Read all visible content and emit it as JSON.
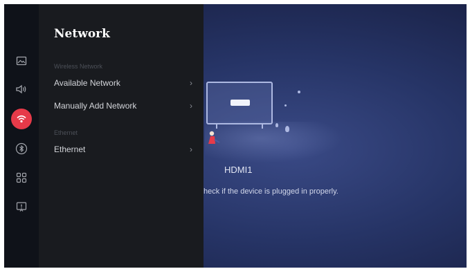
{
  "panel": {
    "title": "Network",
    "sections": [
      {
        "header": "Wireless Network",
        "items": [
          {
            "label": "Available Network"
          },
          {
            "label": "Manually Add Network"
          }
        ]
      },
      {
        "header": "Ethernet",
        "items": [
          {
            "label": "Ethernet"
          }
        ]
      }
    ]
  },
  "rail": {
    "icons": [
      "picture-icon",
      "sound-icon",
      "network-icon",
      "bluetooth-icon",
      "apps-icon",
      "support-icon"
    ],
    "active_icon": "network-icon"
  },
  "background": {
    "source_title": "HDMI1",
    "message": "heck if the device is plugged in properly."
  },
  "colors": {
    "accent": "#e63a49",
    "panel_bg": "#191b1f",
    "rail_bg": "#0f1219",
    "background_blue": "#263466"
  }
}
